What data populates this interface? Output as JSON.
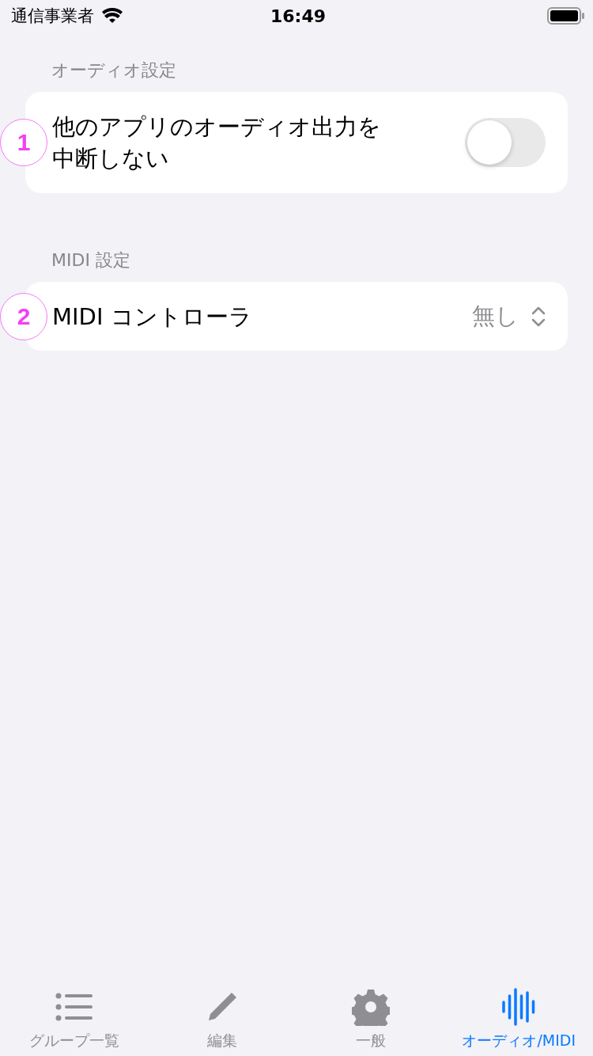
{
  "status_bar": {
    "carrier": "通信事業者",
    "time": "16:49"
  },
  "sections": [
    {
      "header": "オーディオ設定",
      "rows": [
        {
          "kind": "toggle",
          "callout": "1",
          "label": "他のアプリのオーディオ出力を中断しない",
          "on": false
        }
      ]
    },
    {
      "header": "MIDI 設定",
      "rows": [
        {
          "kind": "picker",
          "callout": "2",
          "label": "MIDI コントローラ",
          "value": "無し"
        }
      ]
    }
  ],
  "tab_bar": [
    {
      "label": "グループ一覧",
      "selected": false
    },
    {
      "label": "編集",
      "selected": false
    },
    {
      "label": "一般",
      "selected": false
    },
    {
      "label": "オーディオ/MIDI",
      "selected": true
    }
  ]
}
